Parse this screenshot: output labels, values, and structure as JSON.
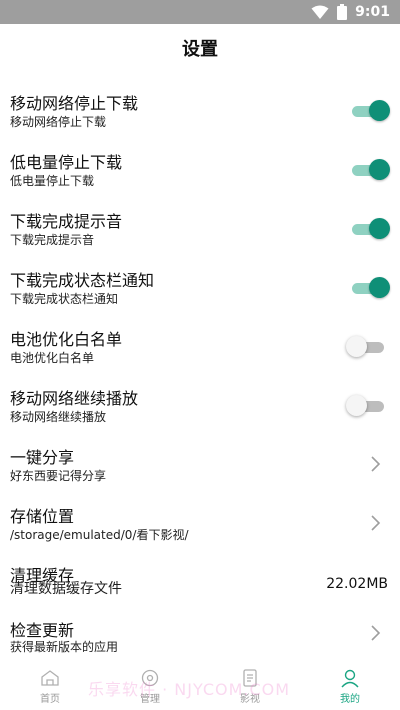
{
  "status_bar": {
    "time": "9:01"
  },
  "header": {
    "title": "设置"
  },
  "settings": [
    {
      "title": "移动网络停止下载",
      "subtitle": "移动网络停止下载",
      "control": "toggle",
      "on": true
    },
    {
      "title": "低电量停止下载",
      "subtitle": "低电量停止下载",
      "control": "toggle",
      "on": true
    },
    {
      "title": "下载完成提示音",
      "subtitle": "下载完成提示音",
      "control": "toggle",
      "on": true
    },
    {
      "title": "下载完成状态栏通知",
      "subtitle": "下载完成状态栏通知",
      "control": "toggle",
      "on": true
    },
    {
      "title": "电池优化白名单",
      "subtitle": "电池优化白名单",
      "control": "toggle",
      "on": false
    },
    {
      "title": "移动网络继续播放",
      "subtitle": "移动网络继续播放",
      "control": "toggle",
      "on": false
    },
    {
      "title": "一键分享",
      "subtitle": "好东西要记得分享",
      "control": "chevron"
    },
    {
      "title": "存储位置",
      "subtitle": "/storage/emulated/0/看下影视/",
      "control": "chevron"
    },
    {
      "title": "清理缓存",
      "subtitle": "清理数据缓存文件",
      "control": "value",
      "value": "22.02MB"
    },
    {
      "title": "检查更新",
      "subtitle": "获得最新版本的应用",
      "control": "chevron"
    }
  ],
  "bottom_nav": [
    {
      "label": "首页",
      "icon": "home-icon",
      "active": false
    },
    {
      "label": "管理",
      "icon": "manage-icon",
      "active": false
    },
    {
      "label": "影视",
      "icon": "video-icon",
      "active": false
    },
    {
      "label": "我的",
      "icon": "profile-icon",
      "active": true
    }
  ],
  "watermark": "乐享软件 · NJYCOM.COM",
  "colors": {
    "accent": "#0f8f77",
    "accent_track": "#8fd1c1",
    "nav_active": "#1aa583",
    "status_bar": "#9e9e9e"
  }
}
